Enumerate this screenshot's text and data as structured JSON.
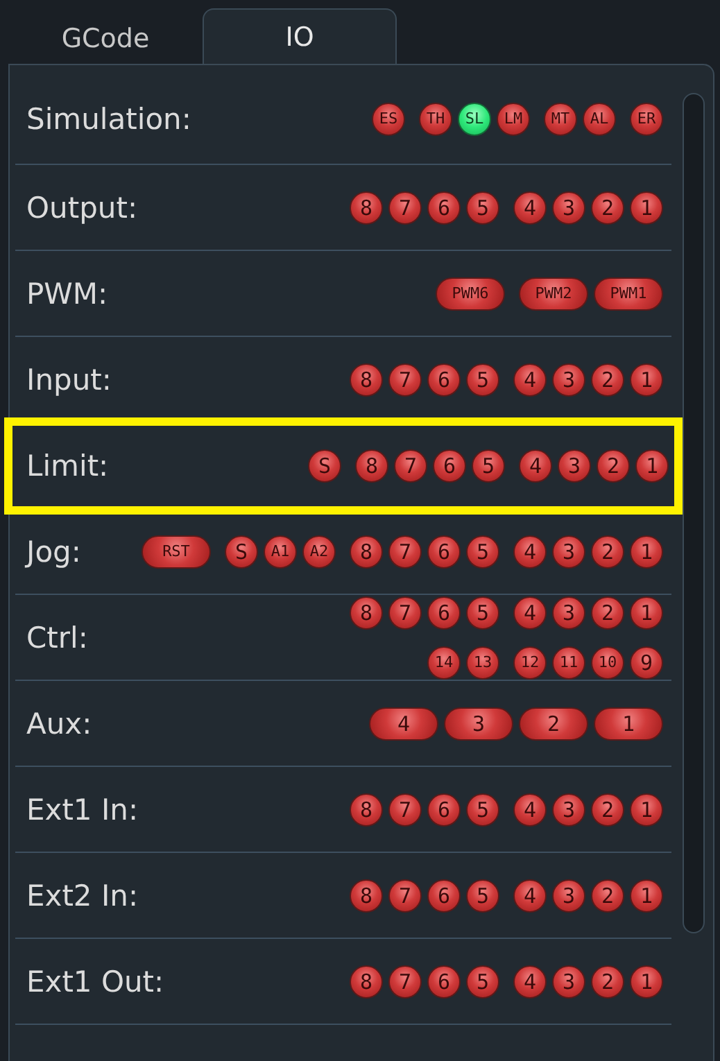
{
  "tabs": [
    {
      "label": "GCode",
      "selected": false
    },
    {
      "label": "IO",
      "selected": true
    }
  ],
  "rows": [
    {
      "label": "Simulation:",
      "highlighted": false,
      "lines": [
        [
          [
            {
              "text": "ES",
              "kind": "round",
              "on": false
            }
          ],
          [
            {
              "text": "TH",
              "kind": "round",
              "on": false
            },
            {
              "text": "SL",
              "kind": "round",
              "on": true
            },
            {
              "text": "LM",
              "kind": "round",
              "on": false
            }
          ],
          [
            {
              "text": "MT",
              "kind": "round",
              "on": false
            },
            {
              "text": "AL",
              "kind": "round",
              "on": false
            }
          ],
          [
            {
              "text": "ER",
              "kind": "round",
              "on": false
            }
          ]
        ]
      ]
    },
    {
      "label": "Output:",
      "highlighted": false,
      "lines": [
        [
          [
            {
              "text": "8",
              "kind": "round",
              "on": false
            },
            {
              "text": "7",
              "kind": "round",
              "on": false
            },
            {
              "text": "6",
              "kind": "round",
              "on": false
            },
            {
              "text": "5",
              "kind": "round",
              "on": false
            }
          ],
          [
            {
              "text": "4",
              "kind": "round",
              "on": false
            },
            {
              "text": "3",
              "kind": "round",
              "on": false
            },
            {
              "text": "2",
              "kind": "round",
              "on": false
            },
            {
              "text": "1",
              "kind": "round",
              "on": false
            }
          ]
        ]
      ]
    },
    {
      "label": "PWM:",
      "highlighted": false,
      "lines": [
        [
          [
            {
              "text": "PWM6",
              "kind": "pill",
              "on": false
            }
          ],
          [
            {
              "text": "PWM2",
              "kind": "pill",
              "on": false
            },
            {
              "text": "PWM1",
              "kind": "pill",
              "on": false
            }
          ]
        ]
      ]
    },
    {
      "label": "Input:",
      "highlighted": false,
      "lines": [
        [
          [
            {
              "text": "8",
              "kind": "round",
              "on": false
            },
            {
              "text": "7",
              "kind": "round",
              "on": false
            },
            {
              "text": "6",
              "kind": "round",
              "on": false
            },
            {
              "text": "5",
              "kind": "round",
              "on": false
            }
          ],
          [
            {
              "text": "4",
              "kind": "round",
              "on": false
            },
            {
              "text": "3",
              "kind": "round",
              "on": false
            },
            {
              "text": "2",
              "kind": "round",
              "on": false
            },
            {
              "text": "1",
              "kind": "round",
              "on": false
            }
          ]
        ]
      ]
    },
    {
      "label": "Limit:",
      "highlighted": true,
      "lines": [
        [
          [
            {
              "text": "S",
              "kind": "round",
              "on": false
            }
          ],
          [
            {
              "text": "8",
              "kind": "round",
              "on": false
            },
            {
              "text": "7",
              "kind": "round",
              "on": false
            },
            {
              "text": "6",
              "kind": "round",
              "on": false
            },
            {
              "text": "5",
              "kind": "round",
              "on": false
            }
          ],
          [
            {
              "text": "4",
              "kind": "round",
              "on": false
            },
            {
              "text": "3",
              "kind": "round",
              "on": false
            },
            {
              "text": "2",
              "kind": "round",
              "on": false
            },
            {
              "text": "1",
              "kind": "round",
              "on": false
            }
          ]
        ]
      ]
    },
    {
      "label": "Jog:",
      "highlighted": false,
      "lines": [
        [
          [
            {
              "text": "RST",
              "kind": "pill",
              "on": false
            }
          ],
          [
            {
              "text": "S",
              "kind": "round",
              "on": false
            },
            {
              "text": "A1",
              "kind": "round",
              "on": false
            },
            {
              "text": "A2",
              "kind": "round",
              "on": false
            }
          ],
          [
            {
              "text": "8",
              "kind": "round",
              "on": false
            },
            {
              "text": "7",
              "kind": "round",
              "on": false
            },
            {
              "text": "6",
              "kind": "round",
              "on": false
            },
            {
              "text": "5",
              "kind": "round",
              "on": false
            }
          ],
          [
            {
              "text": "4",
              "kind": "round",
              "on": false
            },
            {
              "text": "3",
              "kind": "round",
              "on": false
            },
            {
              "text": "2",
              "kind": "round",
              "on": false
            },
            {
              "text": "1",
              "kind": "round",
              "on": false
            }
          ]
        ]
      ]
    },
    {
      "label": "Ctrl:",
      "highlighted": false,
      "lines": [
        [
          [
            {
              "text": "8",
              "kind": "round",
              "on": false
            },
            {
              "text": "7",
              "kind": "round",
              "on": false
            },
            {
              "text": "6",
              "kind": "round",
              "on": false
            },
            {
              "text": "5",
              "kind": "round",
              "on": false
            }
          ],
          [
            {
              "text": "4",
              "kind": "round",
              "on": false
            },
            {
              "text": "3",
              "kind": "round",
              "on": false
            },
            {
              "text": "2",
              "kind": "round",
              "on": false
            },
            {
              "text": "1",
              "kind": "round",
              "on": false
            }
          ]
        ],
        [
          [
            {
              "text": "14",
              "kind": "round",
              "on": false
            },
            {
              "text": "13",
              "kind": "round",
              "on": false
            }
          ],
          [
            {
              "text": "12",
              "kind": "round",
              "on": false
            },
            {
              "text": "11",
              "kind": "round",
              "on": false
            },
            {
              "text": "10",
              "kind": "round",
              "on": false
            },
            {
              "text": "9",
              "kind": "round",
              "on": false
            }
          ]
        ]
      ]
    },
    {
      "label": "Aux:",
      "highlighted": false,
      "lines": [
        [
          [
            {
              "text": "4",
              "kind": "pill",
              "on": false
            },
            {
              "text": "3",
              "kind": "pill",
              "on": false
            },
            {
              "text": "2",
              "kind": "pill",
              "on": false
            },
            {
              "text": "1",
              "kind": "pill",
              "on": false
            }
          ]
        ]
      ]
    },
    {
      "label": "Ext1 In:",
      "highlighted": false,
      "lines": [
        [
          [
            {
              "text": "8",
              "kind": "round",
              "on": false
            },
            {
              "text": "7",
              "kind": "round",
              "on": false
            },
            {
              "text": "6",
              "kind": "round",
              "on": false
            },
            {
              "text": "5",
              "kind": "round",
              "on": false
            }
          ],
          [
            {
              "text": "4",
              "kind": "round",
              "on": false
            },
            {
              "text": "3",
              "kind": "round",
              "on": false
            },
            {
              "text": "2",
              "kind": "round",
              "on": false
            },
            {
              "text": "1",
              "kind": "round",
              "on": false
            }
          ]
        ]
      ]
    },
    {
      "label": "Ext2 In:",
      "highlighted": false,
      "lines": [
        [
          [
            {
              "text": "8",
              "kind": "round",
              "on": false
            },
            {
              "text": "7",
              "kind": "round",
              "on": false
            },
            {
              "text": "6",
              "kind": "round",
              "on": false
            },
            {
              "text": "5",
              "kind": "round",
              "on": false
            }
          ],
          [
            {
              "text": "4",
              "kind": "round",
              "on": false
            },
            {
              "text": "3",
              "kind": "round",
              "on": false
            },
            {
              "text": "2",
              "kind": "round",
              "on": false
            },
            {
              "text": "1",
              "kind": "round",
              "on": false
            }
          ]
        ]
      ]
    },
    {
      "label": "Ext1 Out:",
      "highlighted": false,
      "lines": [
        [
          [
            {
              "text": "8",
              "kind": "round",
              "on": false
            },
            {
              "text": "7",
              "kind": "round",
              "on": false
            },
            {
              "text": "6",
              "kind": "round",
              "on": false
            },
            {
              "text": "5",
              "kind": "round",
              "on": false
            }
          ],
          [
            {
              "text": "4",
              "kind": "round",
              "on": false
            },
            {
              "text": "3",
              "kind": "round",
              "on": false
            },
            {
              "text": "2",
              "kind": "round",
              "on": false
            },
            {
              "text": "1",
              "kind": "round",
              "on": false
            }
          ]
        ]
      ]
    }
  ]
}
